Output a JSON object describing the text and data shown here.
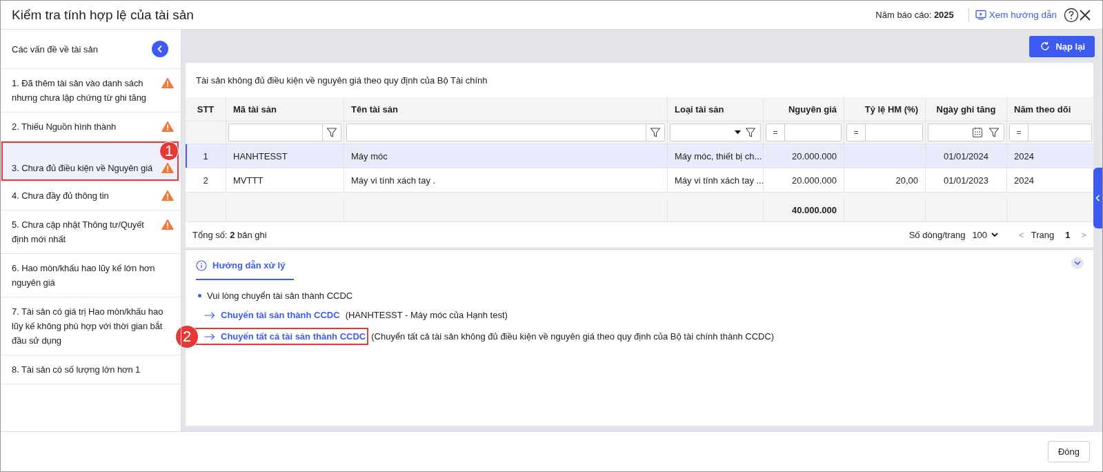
{
  "window": {
    "title": "Kiểm tra tính hợp lệ của tài sản",
    "report_year": "Năm báo cáo: **2025**",
    "guide_link": "Xem hướng dẫn"
  },
  "sidebar": {
    "title": "Các vấn đề về tài sản",
    "items": [
      {
        "label": "1. Đã thêm tài sản vào danh sách nhưng chưa lập chứng từ ghi tăng",
        "warning": true,
        "selected": false
      },
      {
        "label": "2. Thiếu Nguồn hình thành",
        "warning": true,
        "selected": false
      },
      {
        "label": "3. Chưa đủ điều kiện về Nguyên giá",
        "warning": true,
        "selected": true,
        "callout": "1"
      },
      {
        "label": "4. Chưa đầy đủ thông tin",
        "warning": true,
        "selected": false
      },
      {
        "label": "5. Chưa cập nhật Thông tư/Quyết định mới nhất",
        "warning": true,
        "selected": false
      },
      {
        "label": "6. Hao mòn/khấu hao lũy kế lớn hơn nguyên giá",
        "warning": false,
        "selected": false
      },
      {
        "label": "7. Tài sản có giá trị Hao mòn/khấu hao lũy kế không phù hợp với thời gian bắt đầu sử dụng",
        "warning": false,
        "selected": false
      },
      {
        "label": "8. Tài sản có số lượng lớn hơn 1",
        "warning": false,
        "selected": false
      }
    ]
  },
  "toolbar": {
    "reload_button": "Nạp lại"
  },
  "table": {
    "title": "Tài sản không đủ điều kiện về nguyên giá theo quy định của Bộ Tài chính",
    "columns": [
      {
        "label": "STT"
      },
      {
        "label": "Mã tài sản",
        "filter": {
          "kind": "text"
        }
      },
      {
        "label": "Tên tài sản",
        "filter": {
          "kind": "text"
        }
      },
      {
        "label": "Loại tài sản",
        "filter": {
          "kind": "select"
        }
      },
      {
        "label": "Nguyên giá",
        "filter": {
          "kind": "number",
          "operator": "="
        }
      },
      {
        "label": "Tỷ lệ HM (%)",
        "filter": {
          "kind": "number",
          "operator": "="
        }
      },
      {
        "label": "Ngày ghi tăng",
        "filter": {
          "kind": "date"
        }
      },
      {
        "label": "Năm theo dõi",
        "filter": {
          "kind": "number",
          "operator": "="
        }
      }
    ],
    "rows": [
      {
        "selected": true,
        "cells": [
          "1",
          "HANHTESST",
          "Máy móc",
          "Máy móc, thiết bị ch...",
          "20.000.000",
          "",
          "01/01/2024",
          "2024"
        ]
      },
      {
        "selected": false,
        "cells": [
          "2",
          "MVTTT",
          "Máy vi tính xách tay .",
          "Máy vi tính xách tay ...",
          "20.000.000",
          "20,00",
          "01/01/2023",
          "2024"
        ]
      }
    ],
    "total_cost": "40.000.000",
    "total_records": "Tổng số: **2** bản ghi",
    "pagination": {
      "page_size_label": "Số dòng/trang",
      "page_size": "100",
      "prev": "<",
      "page_label": "Trang",
      "page": "1",
      "next": ">"
    }
  },
  "guide": {
    "tabs": [
      {
        "label": "Hướng dẫn xử lý",
        "selected": true
      }
    ],
    "bullet": "Vui lòng chuyển tài sản thành CCDC",
    "actions": [
      {
        "link": "Chuyển tài sản thành CCDC",
        "detail": "(HANHTESST - Máy móc của Hạnh test)"
      },
      {
        "link": "Chuyển tất cả tài sản thành CCDC",
        "detail": "(Chuyển tất cả tài sản không đủ điều kiện về nguyên giá theo quy định của Bộ tài chính thành CCDC)",
        "callout": "2"
      }
    ]
  },
  "footer": {
    "close_button": "Đóng"
  }
}
